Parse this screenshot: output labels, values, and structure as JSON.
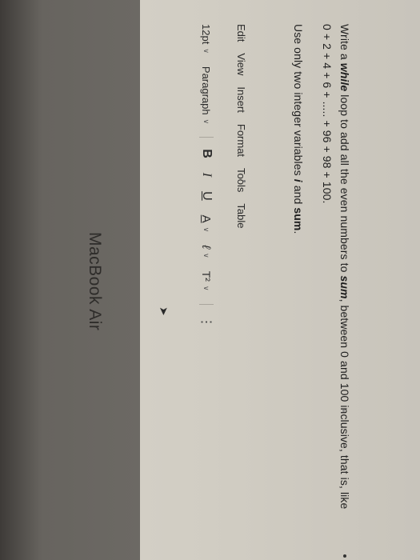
{
  "question": {
    "line1_parts": [
      "Write a ",
      "while",
      " loop  to add all the even numbers to ",
      "sum",
      ", between 0 and 100 inclusive, that is, like"
    ],
    "line2": "0 + 2 + 4 + 6 + ..... + 96 + 98 + 100.",
    "line3_parts": [
      "Use only two integer variables ",
      "i",
      " and ",
      "sum",
      "."
    ]
  },
  "menubar": {
    "items": [
      "Edit",
      "View",
      "Insert",
      "Format",
      "Tools",
      "Table"
    ]
  },
  "toolbar": {
    "font_size": "12pt",
    "block_format": "Paragraph",
    "bold": "B",
    "italic": "I",
    "underline": "U",
    "text_color": "A",
    "highlight": "ℓ",
    "superscript": "T²",
    "more": "⋮"
  },
  "bezel": {
    "brand": "MacBook Air"
  }
}
